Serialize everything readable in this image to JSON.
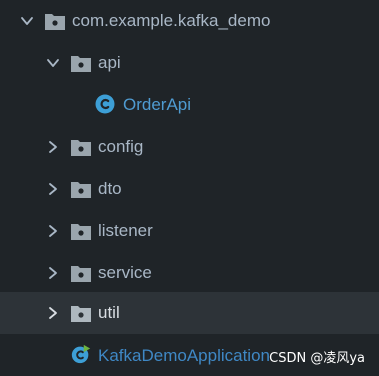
{
  "project_tree": {
    "root": {
      "label": "com.example.kafka_demo",
      "expanded": true,
      "icon": "package-folder-icon"
    },
    "api": {
      "label": "api",
      "expanded": true,
      "icon": "package-folder-icon"
    },
    "order_api": {
      "label": "OrderApi",
      "icon": "java-class-icon"
    },
    "config": {
      "label": "config",
      "expanded": false,
      "icon": "package-folder-icon"
    },
    "dto": {
      "label": "dto",
      "expanded": false,
      "icon": "package-folder-icon"
    },
    "listener": {
      "label": "listener",
      "expanded": false,
      "icon": "package-folder-icon"
    },
    "service": {
      "label": "service",
      "expanded": false,
      "icon": "package-folder-icon"
    },
    "util": {
      "label": "util",
      "expanded": false,
      "selected": true,
      "icon": "package-folder-icon"
    },
    "app": {
      "label": "KafkaDemoApplication",
      "icon": "spring-boot-app-icon"
    }
  },
  "watermark": "CSDN @凌风ya",
  "colors": {
    "background": "#1f2428",
    "selected_row": "#2d3338",
    "label": "#a9b7c6",
    "class_label": "#4f9bd1",
    "folder_icon": "#9aa5ad",
    "class_icon": "#3d9fd6"
  }
}
